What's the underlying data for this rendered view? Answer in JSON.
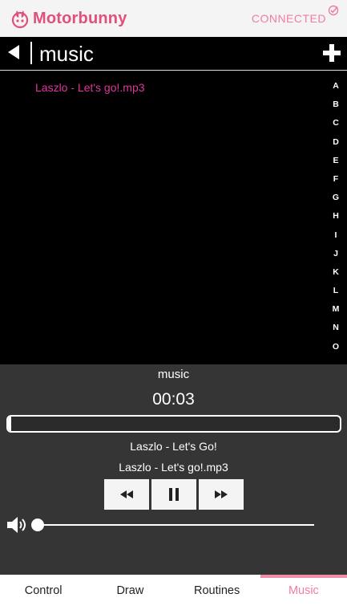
{
  "app": {
    "brand": "Motorbunny",
    "status": "CONNECTED",
    "accent_color": "#e0507a"
  },
  "nav": {
    "title": "music",
    "back_icon": "back-arrow-icon",
    "add_icon": "plus-icon"
  },
  "file_list": {
    "items": [
      "Laszlo - Let's go!.mp3"
    ],
    "index_letters": [
      "A",
      "B",
      "C",
      "D",
      "E",
      "F",
      "G",
      "H",
      "I",
      "J",
      "K",
      "L",
      "M",
      "N",
      "O"
    ]
  },
  "player": {
    "playlist": "music",
    "time": "00:03",
    "progress": 0.01,
    "song_title": "Laszlo - Let's Go!",
    "file_name": "Laszlo - Let's go!.mp3",
    "volume": 0.02,
    "controls": [
      "rewind-icon",
      "pause-icon",
      "fast-forward-icon"
    ]
  },
  "tabs": {
    "items": [
      "Control",
      "Draw",
      "Routines",
      "Music"
    ],
    "active": "Music"
  }
}
